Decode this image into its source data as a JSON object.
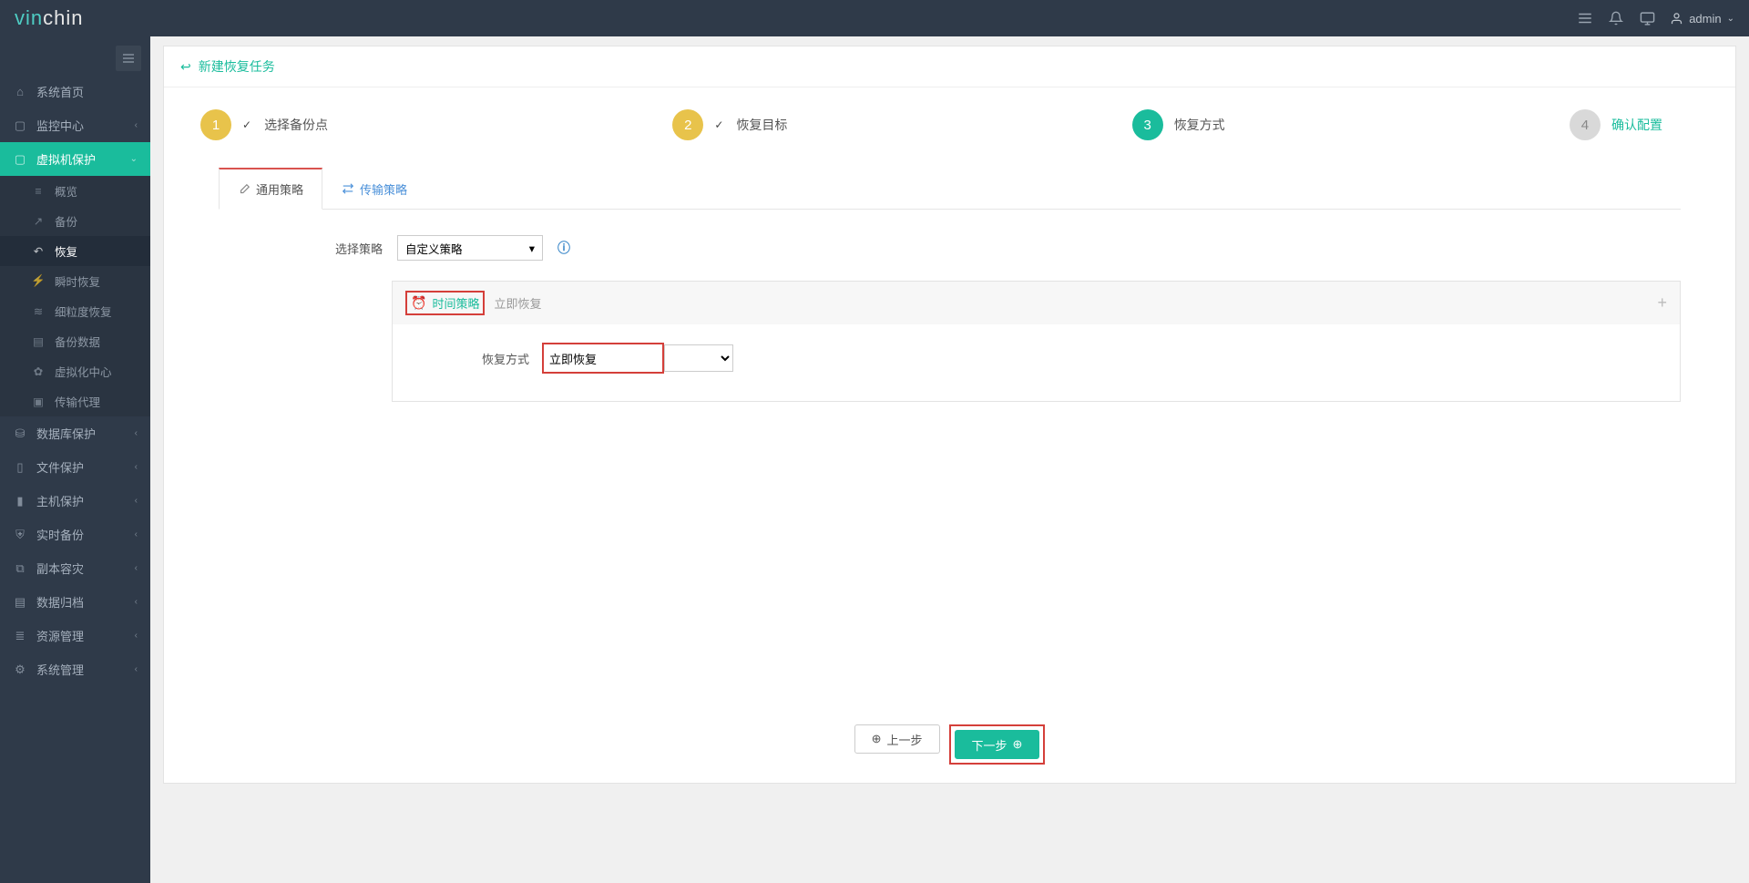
{
  "brand": {
    "part1": "vin",
    "part2": "chin"
  },
  "user": {
    "name": "admin"
  },
  "sidebar": {
    "home": "系统首页",
    "monitor": "监控中心",
    "vmprotect": "虚拟机保护",
    "sub": {
      "overview": "概览",
      "backup": "备份",
      "restore": "恢复",
      "instant": "瞬时恢复",
      "granular": "细粒度恢复",
      "backupdata": "备份数据",
      "virtcenter": "虚拟化中心",
      "transagent": "传输代理"
    },
    "dbprotect": "数据库保护",
    "fileprotect": "文件保护",
    "hostprotect": "主机保护",
    "realtime": "实时备份",
    "replica": "副本容灾",
    "archive": "数据归档",
    "resource": "资源管理",
    "system": "系统管理"
  },
  "page": {
    "title": "新建恢复任务",
    "steps": {
      "s1": "选择备份点",
      "s2": "恢复目标",
      "s3": "恢复方式",
      "s4": "确认配置"
    },
    "tabs": {
      "general": "通用策略",
      "transfer": "传输策略"
    },
    "form": {
      "select_policy_label": "选择策略",
      "select_policy_value": "自定义策略",
      "time_policy": "时间策略",
      "time_policy_sub": "立即恢复",
      "restore_method_label": "恢复方式",
      "restore_method_value": "立即恢复"
    },
    "buttons": {
      "prev": "上一步",
      "next": "下一步"
    }
  }
}
